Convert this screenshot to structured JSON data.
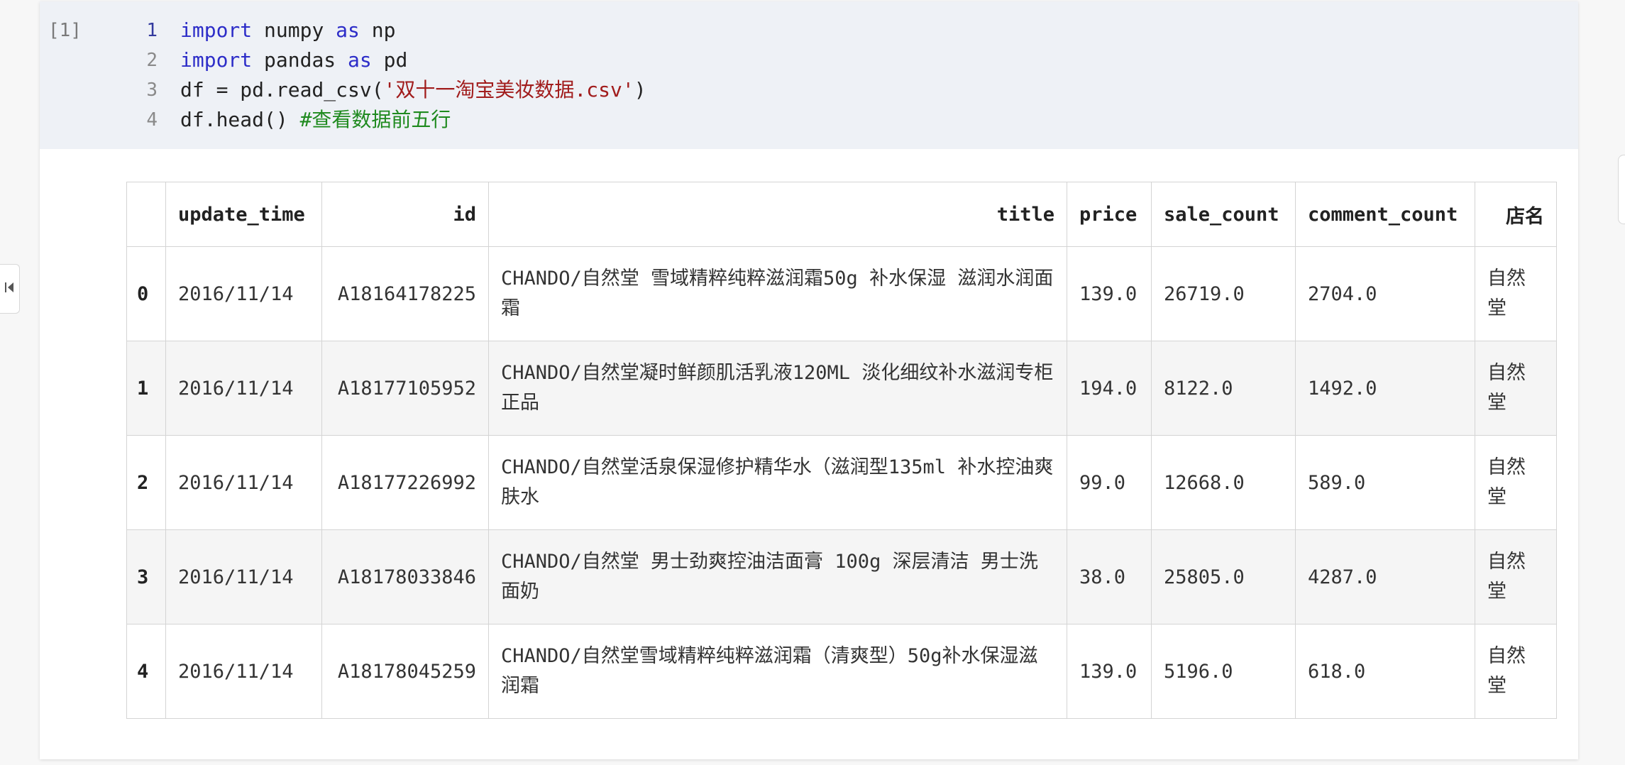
{
  "cell": {
    "exec_count": "[1]",
    "lines": [
      {
        "num": "1",
        "parts": [
          {
            "t": "import",
            "c": "kw"
          },
          {
            "t": " numpy ",
            "c": ""
          },
          {
            "t": "as",
            "c": "kw"
          },
          {
            "t": " np",
            "c": ""
          }
        ]
      },
      {
        "num": "2",
        "parts": [
          {
            "t": "import",
            "c": "kw"
          },
          {
            "t": " pandas ",
            "c": ""
          },
          {
            "t": "as",
            "c": "kw"
          },
          {
            "t": " pd",
            "c": ""
          }
        ]
      },
      {
        "num": "3",
        "parts": [
          {
            "t": "df = pd.read_csv(",
            "c": ""
          },
          {
            "t": "'双十一淘宝美妆数据.csv'",
            "c": "str"
          },
          {
            "t": ")",
            "c": ""
          }
        ]
      },
      {
        "num": "4",
        "parts": [
          {
            "t": "df.head() ",
            "c": ""
          },
          {
            "t": "#查看数据前五行",
            "c": "cmt"
          }
        ]
      }
    ]
  },
  "output": {
    "columns": [
      "",
      "update_time",
      "id",
      "title",
      "price",
      "sale_count",
      "comment_count",
      "店名"
    ],
    "rows": [
      {
        "index": "0",
        "update_time": "2016/11/14",
        "id": "A18164178225",
        "title": "CHANDO/自然堂 雪域精粹纯粹滋润霜50g 补水保湿 滋润水润面霜",
        "price": "139.0",
        "sale_count": "26719.0",
        "comment_count": "2704.0",
        "shop": "自然堂"
      },
      {
        "index": "1",
        "update_time": "2016/11/14",
        "id": "A18177105952",
        "title": "CHANDO/自然堂凝时鲜颜肌活乳液120ML 淡化细纹补水滋润专柜正品",
        "price": "194.0",
        "sale_count": "8122.0",
        "comment_count": "1492.0",
        "shop": "自然堂"
      },
      {
        "index": "2",
        "update_time": "2016/11/14",
        "id": "A18177226992",
        "title": "CHANDO/自然堂活泉保湿修护精华水（滋润型135ml 补水控油爽肤水",
        "price": "99.0",
        "sale_count": "12668.0",
        "comment_count": "589.0",
        "shop": "自然堂"
      },
      {
        "index": "3",
        "update_time": "2016/11/14",
        "id": "A18178033846",
        "title": "CHANDO/自然堂 男士劲爽控油洁面膏 100g 深层清洁 男士洗面奶",
        "price": "38.0",
        "sale_count": "25805.0",
        "comment_count": "4287.0",
        "shop": "自然堂"
      },
      {
        "index": "4",
        "update_time": "2016/11/14",
        "id": "A18178045259",
        "title": "CHANDO/自然堂雪域精粹纯粹滋润霜（清爽型）50g补水保湿滋润霜",
        "price": "139.0",
        "sale_count": "5196.0",
        "comment_count": "618.0",
        "shop": "自然堂"
      }
    ]
  },
  "icons": {
    "sidebar_toggle": "collapse-left-icon"
  }
}
